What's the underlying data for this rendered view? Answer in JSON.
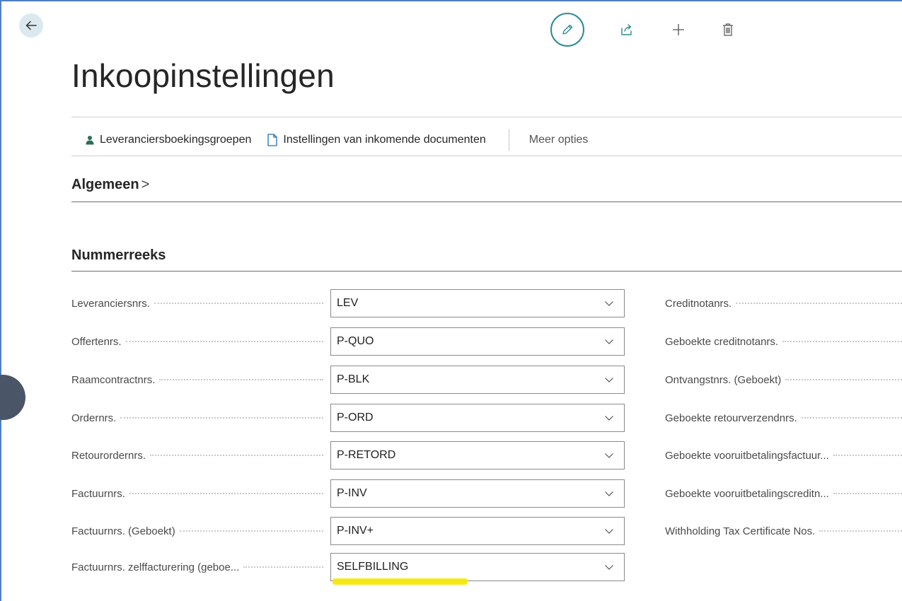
{
  "page": {
    "title": "Inkoopinstellingen"
  },
  "toolbar": {
    "back_icon": "arrow-left-icon",
    "edit_icon": "pencil-icon",
    "share_icon": "share-icon",
    "add_icon": "plus-icon",
    "delete_icon": "trash-icon"
  },
  "actions": {
    "vendor_posting_groups": "Leveranciersboekingsgroepen",
    "incoming_documents_setup": "Instellingen van inkomende documenten",
    "more_options": "Meer opties"
  },
  "sections": {
    "general": "Algemeen",
    "general_chevron": ">",
    "number_series": "Nummerreeks"
  },
  "fields_left": [
    {
      "label": "Leveranciersnrs.",
      "value": "LEV"
    },
    {
      "label": "Offertenrs.",
      "value": "P-QUO"
    },
    {
      "label": "Raamcontractnrs.",
      "value": "P-BLK"
    },
    {
      "label": "Ordernrs.",
      "value": "P-ORD"
    },
    {
      "label": "Retourordernrs.",
      "value": "P-RETORD"
    },
    {
      "label": "Factuurnrs.",
      "value": "P-INV"
    },
    {
      "label": "Factuurnrs. (Geboekt)",
      "value": "P-INV+"
    },
    {
      "label": "Factuurnrs. zelffacturering (geboe...",
      "value": "SELFBILLING"
    }
  ],
  "fields_right": [
    {
      "label": "Creditnotanrs."
    },
    {
      "label": "Geboekte creditnotanrs."
    },
    {
      "label": "Ontvangstnrs. (Geboekt)"
    },
    {
      "label": "Geboekte retourverzendnrs."
    },
    {
      "label": "Geboekte vooruitbetalingsfactuur..."
    },
    {
      "label": "Geboekte vooruitbetalingscreditn..."
    },
    {
      "label": "Withholding Tax Certificate Nos."
    }
  ],
  "colors": {
    "accent": "#2d8a99",
    "highlight": "#f5e800",
    "frame": "#4f7fc1"
  }
}
